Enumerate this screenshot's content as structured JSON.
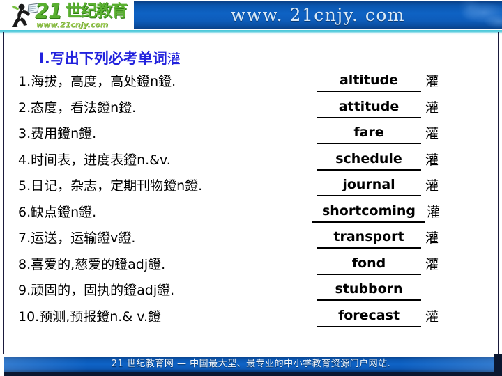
{
  "header": {
    "logo_number": "21",
    "logo_cjk": "世纪教育",
    "logo_sub": "www.21cnjy.com",
    "banner_url": "www. 21cnjy. com"
  },
  "slide": {
    "title_main": "Ⅰ.写出下列必考单词",
    "title_tail": "灌"
  },
  "items": [
    {
      "prompt": "1.海拔，高度，高处鐙n鐙.",
      "answer": "altitude",
      "cjk": "灌",
      "wide": false
    },
    {
      "prompt": "2.态度，看法鐙n鐙.",
      "answer": "attitude",
      "cjk": "灌",
      "wide": false
    },
    {
      "prompt": "3.费用鐙n鐙.",
      "answer": "fare",
      "cjk": "灌",
      "wide": false
    },
    {
      "prompt": "4.时间表，进度表鐙n.&v.",
      "answer": "schedule",
      "cjk": "灌",
      "wide": false
    },
    {
      "prompt": "5.日记，杂志，定期刊物鐙n鐙.",
      "answer": "journal",
      "cjk": "灌",
      "wide": false
    },
    {
      "prompt": "6.缺点鐙n鐙.",
      "answer": "shortcoming",
      "cjk": "灌",
      "wide": true
    },
    {
      "prompt": "7.运送，运输鐙v鐙.",
      "answer": "transport",
      "cjk": "灌",
      "wide": false
    },
    {
      "prompt": "8.喜爱的,慈爱的鐙adj鐙.",
      "answer": "fond",
      "cjk": "灌",
      "wide": false
    },
    {
      "prompt": "9.顽固的，固执的鐙adj鐙.",
      "answer": "stubborn",
      "cjk": "",
      "wide": false
    },
    {
      "prompt": "10.预测,预报鐙n.& v.鐙",
      "answer": "forecast",
      "cjk": "灌",
      "wide": false
    }
  ],
  "footer": {
    "text": "21 世纪教育网 — 中国最大型、最专业的中小学教育资源门户网站."
  },
  "colors": {
    "title_blue": "#2222dd",
    "banner_blue": "#0e62c4",
    "logo_green": "#5ab031",
    "teal_rule": "#4ec9da"
  }
}
